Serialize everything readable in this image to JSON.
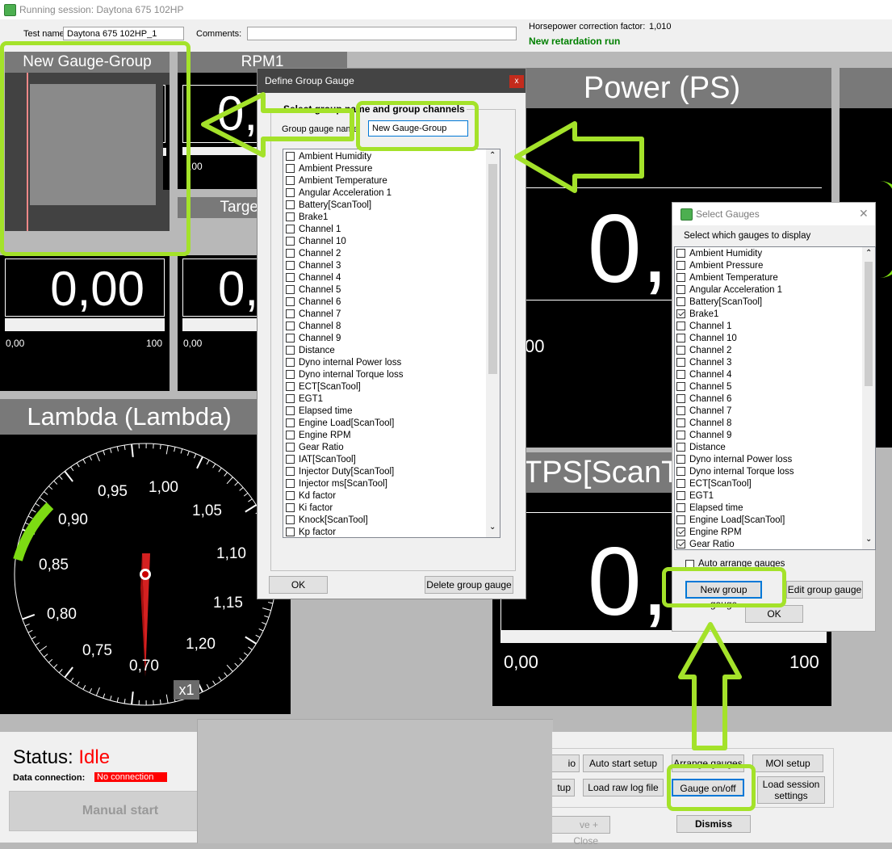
{
  "window": {
    "title": "Running session: Daytona 675 102HP"
  },
  "info": {
    "test_name_label": "Test name:",
    "test_name_value": "Daytona 675 102HP_1",
    "comments_label": "Comments:",
    "comments_value": "",
    "hp_label": "Horsepower correction factor:",
    "hp_value": "1,010",
    "status_line": "New retardation run"
  },
  "gauges": {
    "group": {
      "title": "New Gauge-Group"
    },
    "rpm": {
      "title": "RPM1",
      "value": "0,",
      "scale_left": ",00"
    },
    "target": {
      "title": "Targe"
    },
    "left_small": {
      "value": "0,00",
      "min": "0,00",
      "max": "100"
    },
    "mid_small": {
      "value": "0,",
      "min": "0,00"
    },
    "power": {
      "title": "Power (PS)",
      "value": "0,",
      "min_partial": "00"
    },
    "tps": {
      "title": "TPS[ScanT",
      "value": "0,",
      "min": "0,00",
      "max": "100"
    },
    "lambda": {
      "title": "Lambda (Lambda)",
      "ticks": [
        "0,70",
        "0,75",
        "0,80",
        "0,85",
        "0,90",
        "0,95",
        "1,00",
        "1,05",
        "1,10",
        "1,15",
        "1,20"
      ],
      "multiplier": "x1"
    }
  },
  "define_dialog": {
    "title": "Define Group Gauge",
    "close": "x",
    "group_label": "Select group name and group channels",
    "name_label": "Group gauge name",
    "name_value": "New Gauge-Group",
    "items": [
      "Ambient Humidity",
      "Ambient Pressure",
      "Ambient Temperature",
      "Angular Acceleration 1",
      "Battery[ScanTool]",
      "Brake1",
      "Channel 1",
      "Channel 10",
      "Channel 2",
      "Channel 3",
      "Channel 4",
      "Channel 5",
      "Channel 6",
      "Channel 7",
      "Channel 8",
      "Channel 9",
      "Distance",
      "Dyno internal Power loss",
      "Dyno internal Torque loss",
      "ECT[ScanTool]",
      "EGT1",
      "Elapsed time",
      "Engine Load[ScanTool]",
      "Engine RPM",
      "Gear Ratio",
      "IAT[ScanTool]",
      "Injector Duty[ScanTool]",
      "Injector ms[ScanTool]",
      "Kd factor",
      "Ki factor",
      "Knock[ScanTool]",
      "Kp factor"
    ],
    "ok": "OK",
    "delete": "Delete group gauge"
  },
  "select_dialog": {
    "title": "Select Gauges",
    "close": "✕",
    "instruction": "Select which gauges to display",
    "items": [
      {
        "label": "Ambient Humidity",
        "checked": false
      },
      {
        "label": "Ambient Pressure",
        "checked": false
      },
      {
        "label": "Ambient Temperature",
        "checked": false
      },
      {
        "label": "Angular Acceleration 1",
        "checked": false
      },
      {
        "label": "Battery[ScanTool]",
        "checked": false
      },
      {
        "label": "Brake1",
        "checked": true
      },
      {
        "label": "Channel 1",
        "checked": false
      },
      {
        "label": "Channel 10",
        "checked": false
      },
      {
        "label": "Channel 2",
        "checked": false
      },
      {
        "label": "Channel 3",
        "checked": false
      },
      {
        "label": "Channel 4",
        "checked": false
      },
      {
        "label": "Channel 5",
        "checked": false
      },
      {
        "label": "Channel 6",
        "checked": false
      },
      {
        "label": "Channel 7",
        "checked": false
      },
      {
        "label": "Channel 8",
        "checked": false
      },
      {
        "label": "Channel 9",
        "checked": false
      },
      {
        "label": "Distance",
        "checked": false
      },
      {
        "label": "Dyno internal Power loss",
        "checked": false
      },
      {
        "label": "Dyno internal Torque loss",
        "checked": false
      },
      {
        "label": "ECT[ScanTool]",
        "checked": false
      },
      {
        "label": "EGT1",
        "checked": false
      },
      {
        "label": "Elapsed time",
        "checked": false
      },
      {
        "label": "Engine Load[ScanTool]",
        "checked": false
      },
      {
        "label": "Engine RPM",
        "checked": true
      },
      {
        "label": "Gear Ratio",
        "checked": true
      }
    ],
    "auto_arrange": "Auto arrange gauges",
    "new_group": "New group gauge",
    "edit_group": "Edit group gauge",
    "ok": "OK"
  },
  "status": {
    "label": "Status:",
    "value": "Idle",
    "conn_label": "Data connection:",
    "conn_value": "No connection",
    "manual_start": "Manual start"
  },
  "buttons": {
    "io_partial": "io",
    "auto_start": "Auto start setup",
    "arrange": "Arrange gauges",
    "moi": "MOI setup",
    "tup_partial": "tup",
    "load_raw": "Load raw log file",
    "gauge_onoff": "Gauge on/off",
    "load_session": "Load session settings",
    "save_close": "ve + Close",
    "dismiss": "Dismiss"
  },
  "colors": {
    "highlight": "#a4e22a",
    "status_idle": "#ff0000",
    "no_conn_bg": "#ff0000"
  }
}
